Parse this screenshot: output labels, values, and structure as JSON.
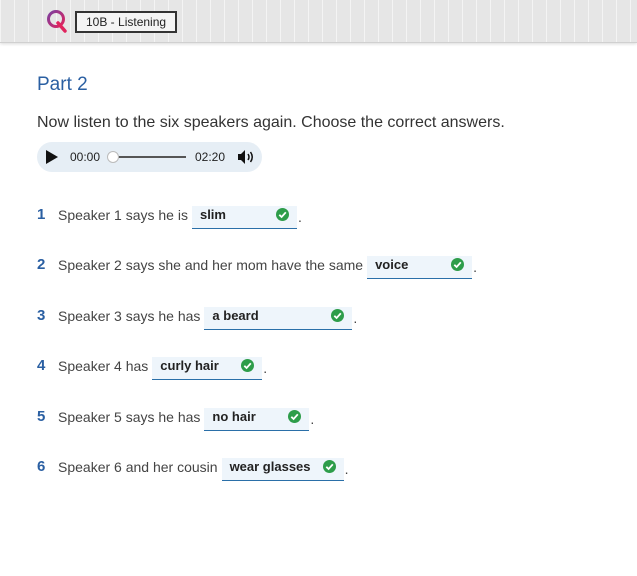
{
  "header": {
    "unit_label": "10B - Listening"
  },
  "part_title": "Part 2",
  "instructions": "Now listen to the six speakers again. Choose the correct answers.",
  "player": {
    "current_time": "00:00",
    "total_time": "02:20",
    "progress": 0.0
  },
  "questions": [
    {
      "number": "1",
      "prompt": "Speaker 1 says he is",
      "answer": "slim",
      "status": "correct"
    },
    {
      "number": "2",
      "prompt": "Speaker 2 says she and her mom have the same",
      "answer": "voice",
      "status": "correct"
    },
    {
      "number": "3",
      "prompt": "Speaker 3 says he has",
      "answer": "a beard",
      "status": "correct"
    },
    {
      "number": "4",
      "prompt": "Speaker 4 has",
      "answer": "curly hair",
      "status": "correct"
    },
    {
      "number": "5",
      "prompt": "Speaker 5 says he has",
      "answer": "no hair",
      "status": "correct"
    },
    {
      "number": "6",
      "prompt": "Speaker 6 and her cousin",
      "answer": "wear glasses",
      "status": "correct"
    }
  ],
  "colors": {
    "accent": "#2a5fa2",
    "check": "#2e9d4a",
    "logo_red": "#e0245e",
    "logo_purple": "#7b3fa0"
  },
  "icons": {
    "logo": "brand-logo-icon",
    "play": "play-icon",
    "volume": "volume-icon",
    "check": "check-circle-icon"
  }
}
